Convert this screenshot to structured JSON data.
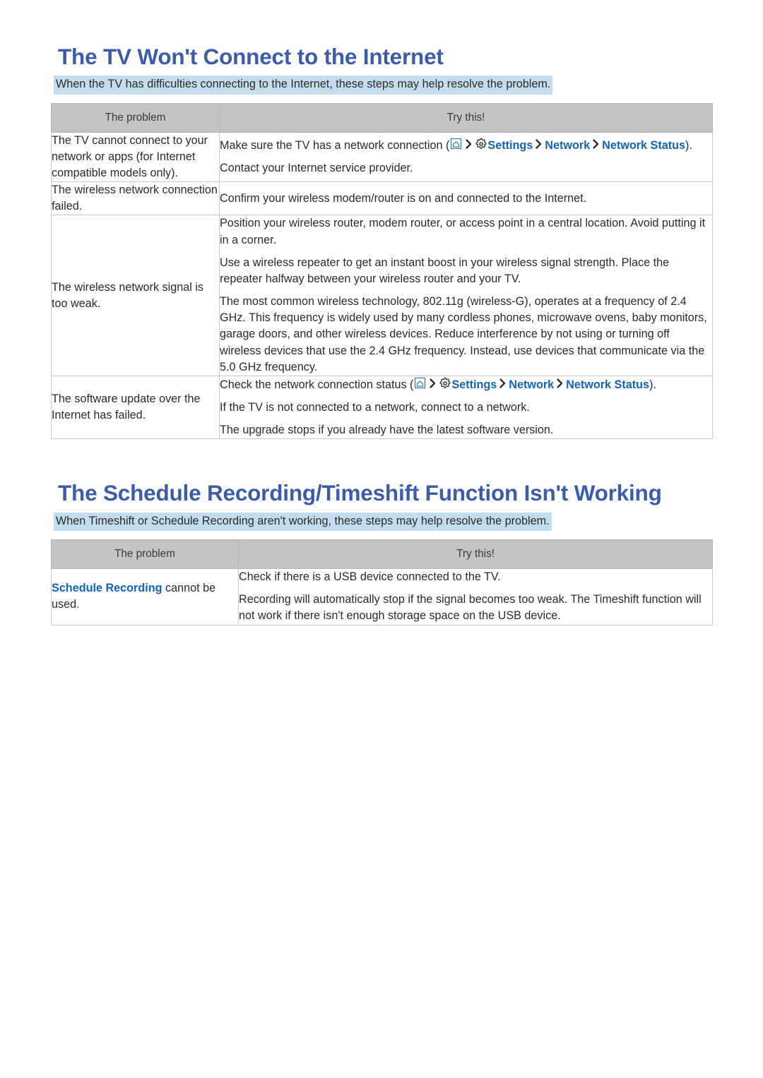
{
  "sections": [
    {
      "title": "The TV Won't Connect to the Internet",
      "subtitle": "When the TV has difficulties connecting to the Internet, these steps may help resolve the problem.",
      "table": {
        "headers": [
          "The problem",
          "Try this!"
        ],
        "rows": [
          {
            "problem": "The TV cannot connect to your network or apps (for Internet compatible models only).",
            "try": {
              "line1_prefix": "Make sure the TV has a network connection (",
              "line1_settings": "Settings",
              "line1_network": "Network",
              "line1_network_status": "Network Status",
              "line1_suffix": ").",
              "line2": "Contact your Internet service provider."
            }
          },
          {
            "problem": "The wireless network connection failed.",
            "try": {
              "line1": "Confirm your wireless modem/router is on and connected to the Internet."
            }
          },
          {
            "problem": "The wireless network signal is too weak.",
            "try": {
              "line1": "Position your wireless router, modem router, or access point in a central location. Avoid putting it in a corner.",
              "line2": "Use a wireless repeater to get an instant boost in your wireless signal strength. Place the repeater halfway between your wireless router and your TV.",
              "line3": "The most common wireless technology, 802.11g (wireless-G), operates at a frequency of 2.4 GHz. This frequency is widely used by many cordless phones, microwave ovens, baby monitors, garage doors, and other wireless devices. Reduce interference by not using or turning off wireless devices that use the 2.4 GHz frequency. Instead, use devices that communicate via the 5.0 GHz frequency."
            }
          },
          {
            "problem": "The software update over the Internet has failed.",
            "try": {
              "line1_prefix": "Check the network connection status (",
              "line1_settings": "Settings",
              "line1_network": "Network",
              "line1_network_status": "Network Status",
              "line1_suffix": ").",
              "line2": "If the TV is not connected to a network, connect to a network.",
              "line3": "The upgrade stops if you already have the latest software version."
            }
          }
        ]
      }
    },
    {
      "title": "The Schedule Recording/Timeshift Function Isn't Working",
      "subtitle": "When Timeshift or Schedule Recording aren't working, these steps may help resolve the problem.",
      "table": {
        "headers": [
          "The problem",
          "Try this!"
        ],
        "rows": [
          {
            "problem_link": "Schedule Recording",
            "problem_rest": " cannot be used.",
            "try": {
              "line1": "Check if there is a USB device connected to the TV.",
              "line2": "Recording will automatically stop if the signal becomes too weak. The Timeshift function will not work if there isn't enough storage space on the USB device."
            }
          }
        ]
      }
    }
  ],
  "icons": {
    "home": "home-icon",
    "gear": "gear-icon",
    "chevron": "chevron-right-icon"
  },
  "colors": {
    "heading": "#3b5ca8",
    "link": "#1464b4",
    "highlight": "#c3dcee",
    "table_header_bg": "#c4c4c4",
    "home_icon": "#3c7f96"
  }
}
